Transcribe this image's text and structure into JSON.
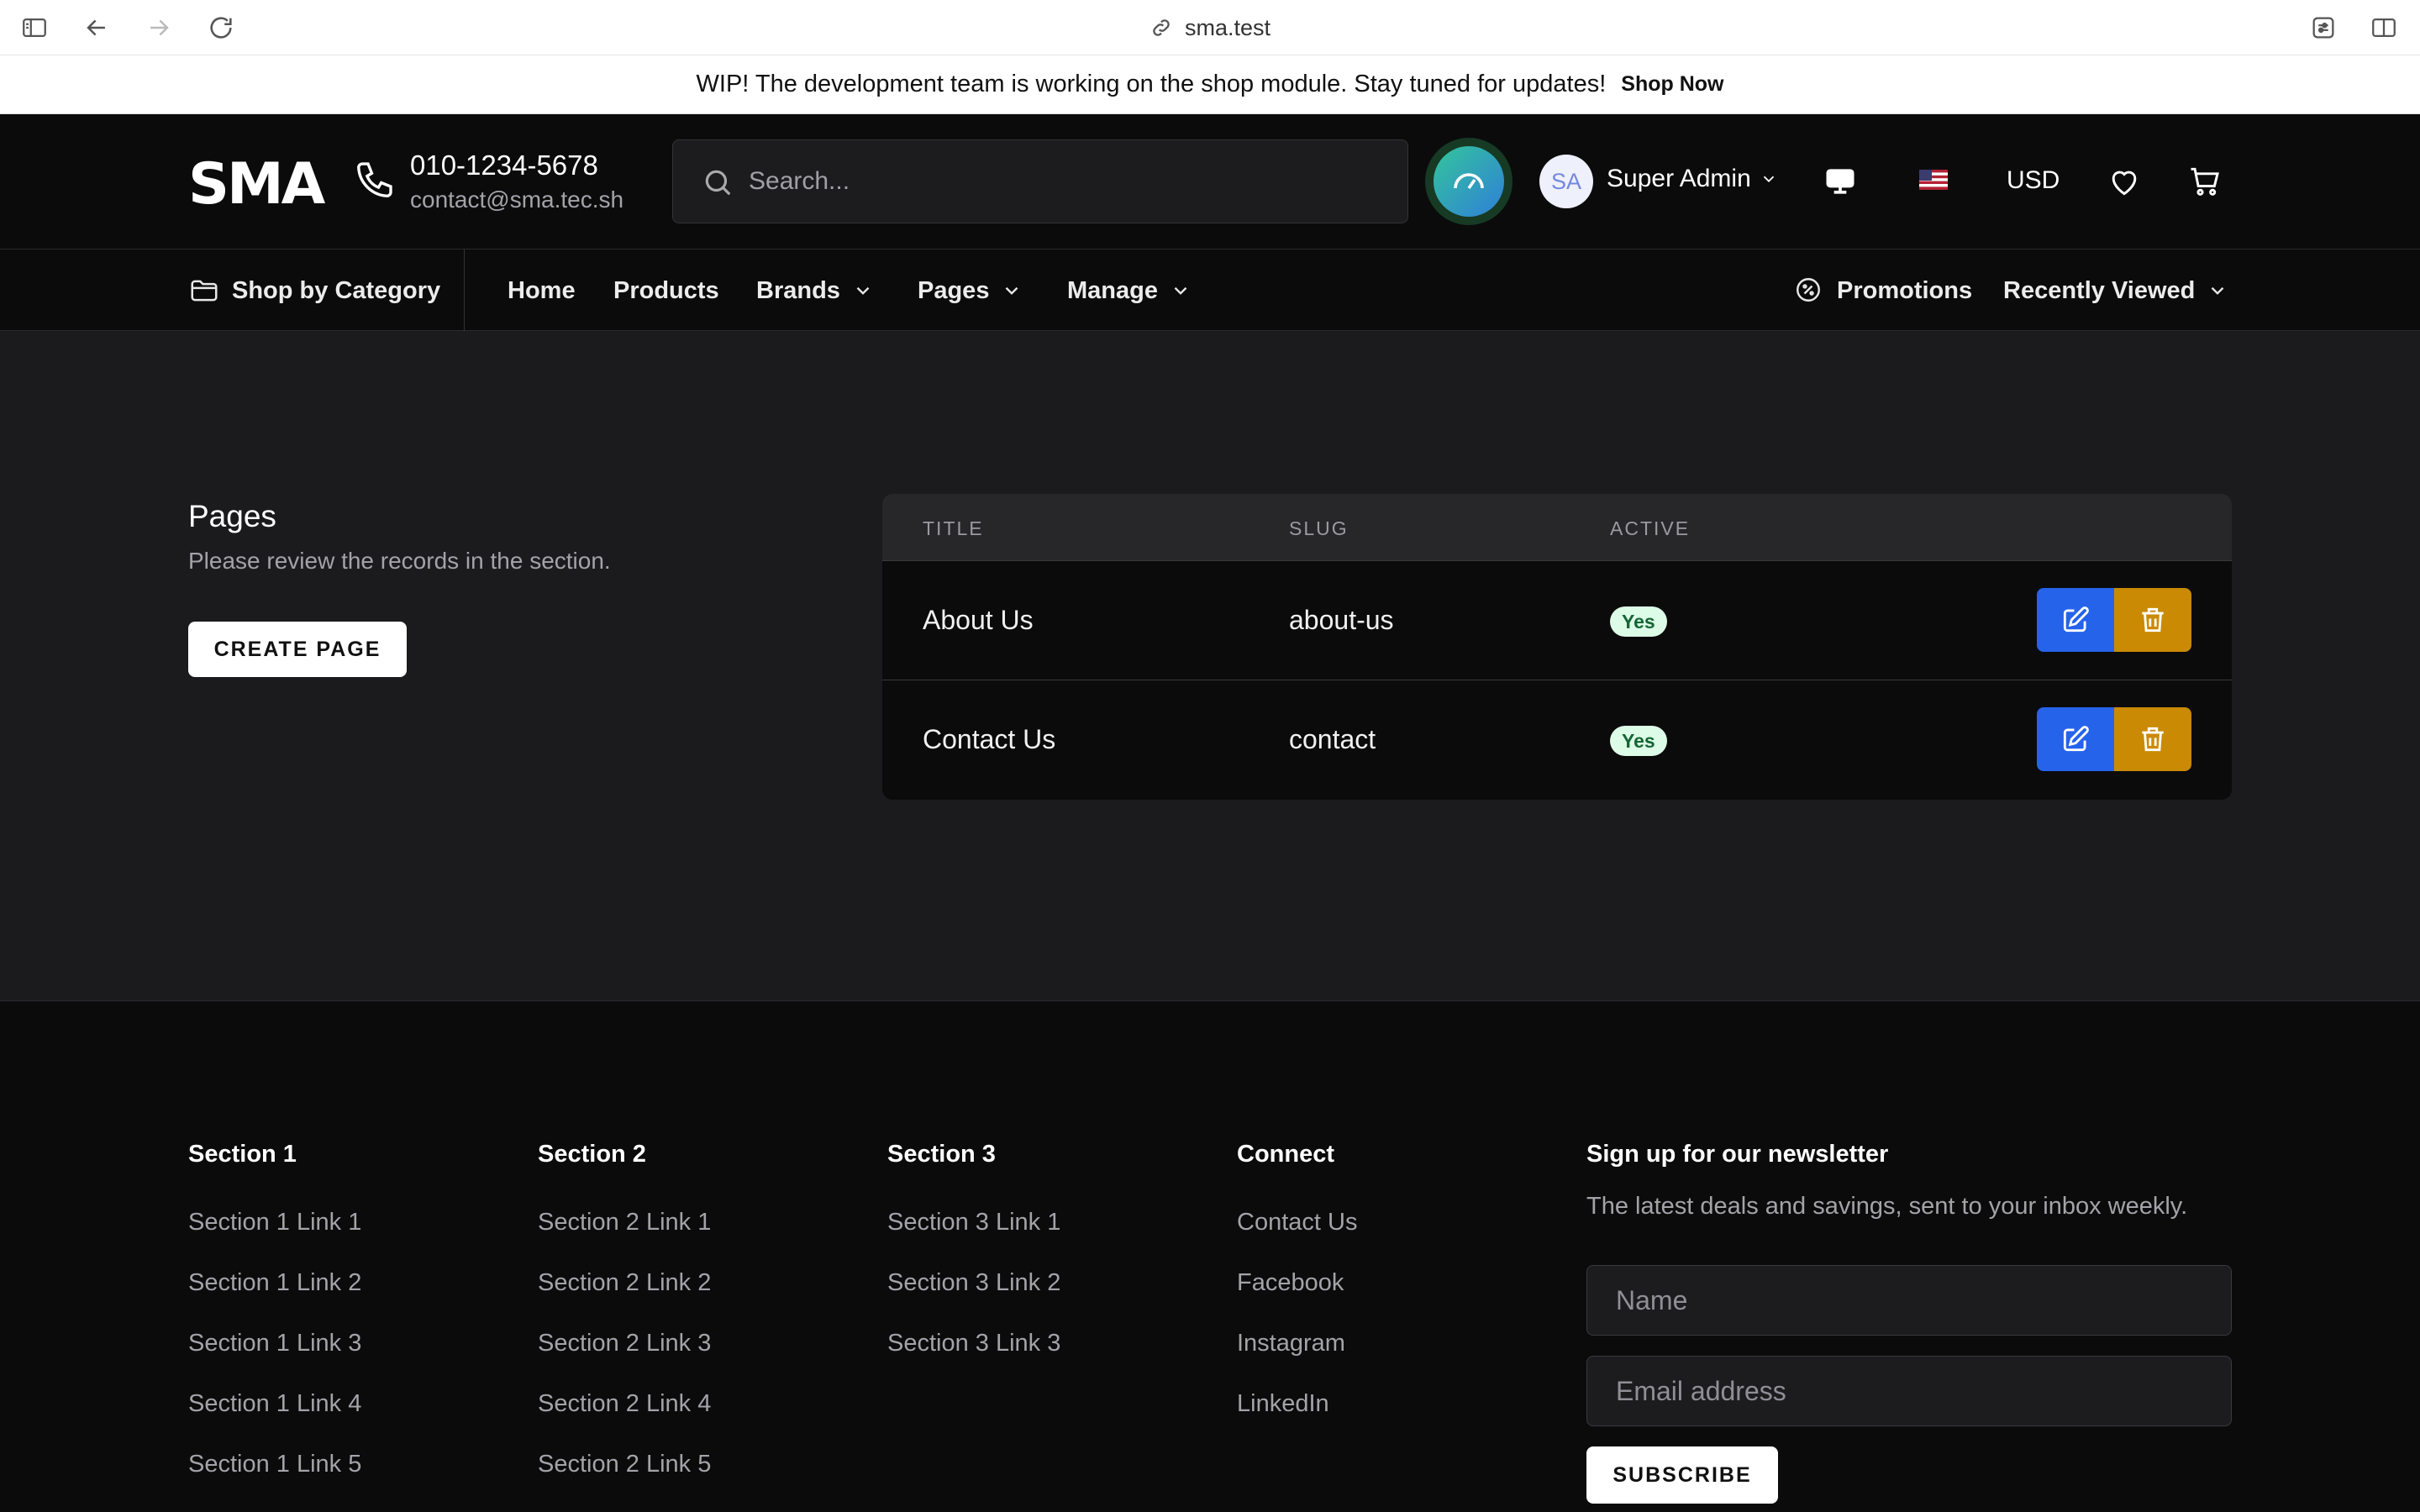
{
  "browser": {
    "url": "sma.test"
  },
  "announcement": {
    "text": "WIP! The development team is working on the shop module. Stay tuned for updates!",
    "link": "Shop Now"
  },
  "header": {
    "logo": "SMA",
    "phone": "010-1234-5678",
    "email": "contact@sma.tec.sh",
    "search_placeholder": "Search...",
    "avatar_initials": "SA",
    "user_name": "Super Admin",
    "currency": "USD"
  },
  "nav": {
    "category": "Shop by Category",
    "items": [
      "Home",
      "Products",
      "Brands",
      "Pages",
      "Manage"
    ],
    "promotions": "Promotions",
    "recently_viewed": "Recently Viewed"
  },
  "main": {
    "title": "Pages",
    "description": "Please review the records in the section.",
    "create_button": "CREATE PAGE",
    "table": {
      "columns": [
        "TITLE",
        "SLUG",
        "ACTIVE"
      ],
      "rows": [
        {
          "title": "About Us",
          "slug": "about-us",
          "active": "Yes"
        },
        {
          "title": "Contact Us",
          "slug": "contact",
          "active": "Yes"
        }
      ]
    }
  },
  "footer": {
    "sections": [
      {
        "heading": "Section 1",
        "links": [
          "Section 1 Link 1",
          "Section 1 Link 2",
          "Section 1 Link 3",
          "Section 1 Link 4",
          "Section 1 Link 5"
        ]
      },
      {
        "heading": "Section 2",
        "links": [
          "Section 2 Link 1",
          "Section 2 Link 2",
          "Section 2 Link 3",
          "Section 2 Link 4",
          "Section 2 Link 5"
        ]
      },
      {
        "heading": "Section 3",
        "links": [
          "Section 3 Link 1",
          "Section 3 Link 2",
          "Section 3 Link 3"
        ]
      },
      {
        "heading": "Connect",
        "links": [
          "Contact Us",
          "Facebook",
          "Instagram",
          "LinkedIn"
        ]
      }
    ],
    "newsletter": {
      "title": "Sign up for our newsletter",
      "description": "The latest deals and savings, sent to your inbox weekly.",
      "name_placeholder": "Name",
      "email_placeholder": "Email address",
      "button": "SUBSCRIBE"
    }
  },
  "colors": {
    "edit": "#2563eb",
    "delete": "#ca8a04",
    "badge_bg": "#dcfce7",
    "badge_text": "#166534"
  }
}
